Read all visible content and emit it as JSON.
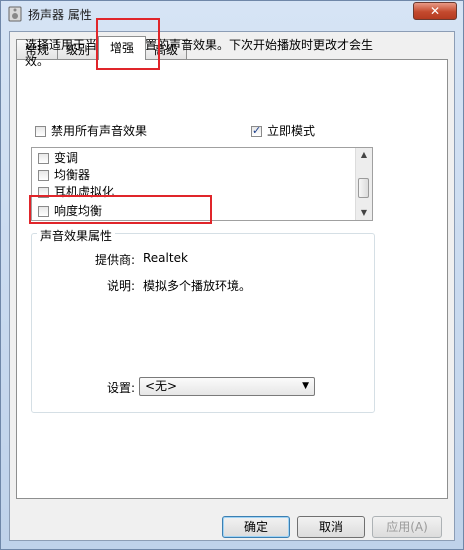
{
  "window": {
    "title": "扬声器 属性",
    "close_glyph": "✕"
  },
  "tabs": [
    {
      "label": "常规",
      "active": false
    },
    {
      "label": "级别",
      "active": false
    },
    {
      "label": "增强",
      "active": true
    },
    {
      "label": "高级",
      "active": false
    }
  ],
  "enhancement": {
    "description": "选择适用于当前聆听配置的声音效果。下次开始播放时更改才会生效。",
    "disable_all_label": "禁用所有声音效果",
    "disable_all_checked": false,
    "immediate_mode_label": "立即模式",
    "immediate_mode_checked": true,
    "effects": [
      {
        "label": "变调",
        "checked": false
      },
      {
        "label": "均衡器",
        "checked": false
      },
      {
        "label": "耳机虚拟化",
        "checked": false
      },
      {
        "label": "响度均衡",
        "checked": false
      }
    ]
  },
  "properties": {
    "group_title": "声音效果属性",
    "provider_label": "提供商:",
    "provider_value": "Realtek",
    "desc_label": "说明:",
    "desc_value": "模拟多个播放环境。",
    "setting_label": "设置:",
    "setting_value": "<无>"
  },
  "buttons": {
    "ok": "确定",
    "cancel": "取消",
    "apply": "应用(A)"
  },
  "colors": {
    "annotation": "#e0252a",
    "title_bar": "#c9d8ec"
  }
}
